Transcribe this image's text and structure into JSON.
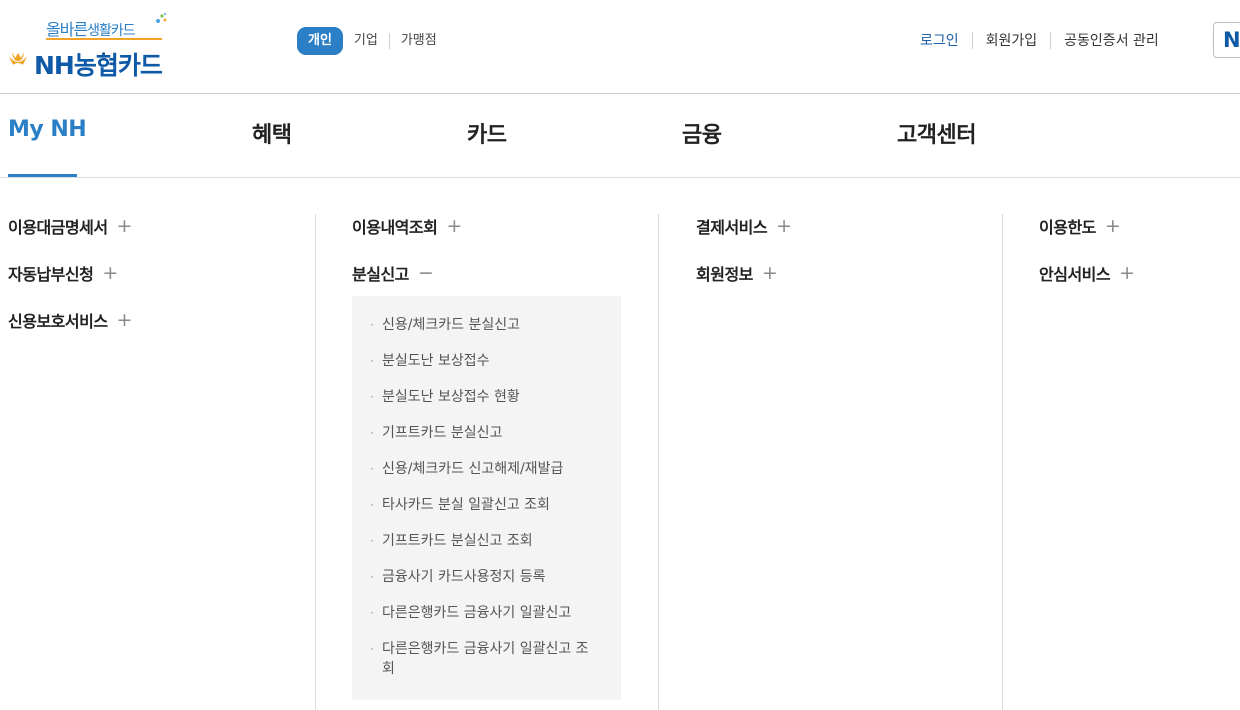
{
  "header": {
    "logo": {
      "slogan_main": "올바른",
      "slogan_sub": "생활카드",
      "brand": "NH농협카드"
    },
    "segments": {
      "active": "개인",
      "items": [
        "기업",
        "가맹점"
      ]
    },
    "util_links": [
      "로그인",
      "회원가입",
      "공동인증서 관리"
    ],
    "lang_button": "N"
  },
  "gnb": {
    "items": [
      "My NH",
      "혜택",
      "카드",
      "금융",
      "고객센터"
    ],
    "active_index": 0
  },
  "submenu": {
    "columns": [
      {
        "items": [
          {
            "label": "이용대금명세서",
            "toggle": "+"
          },
          {
            "label": "자동납부신청",
            "toggle": "+"
          },
          {
            "label": "신용보호서비스",
            "toggle": "+"
          }
        ]
      },
      {
        "items": [
          {
            "label": "이용내역조회",
            "toggle": "+"
          },
          {
            "label": "분실신고",
            "toggle": "−"
          }
        ]
      },
      {
        "items": [
          {
            "label": "결제서비스",
            "toggle": "+"
          },
          {
            "label": "회원정보",
            "toggle": "+"
          }
        ]
      },
      {
        "items": [
          {
            "label": "이용한도",
            "toggle": "+"
          },
          {
            "label": "안심서비스",
            "toggle": "+"
          }
        ]
      }
    ],
    "expanded_panel": {
      "bullet": "·",
      "items": [
        "신용/체크카드 분실신고",
        "분실도난 보상접수",
        "분실도난 보상접수 현황",
        "기프트카드 분실신고",
        "신용/체크카드 신고해제/재발급",
        "타사카드 분실 일괄신고 조회",
        "기프트카드 분실신고 조회",
        "금융사기 카드사용정지 등록",
        "다른은행카드 금융사기 일괄신고",
        "다른은행카드 금융사기 일괄신고 조회"
      ]
    }
  },
  "colors": {
    "accent": "#2a7fc6",
    "brand_navy": "#0e5aa7",
    "panel_bg": "#f4f4f4"
  }
}
